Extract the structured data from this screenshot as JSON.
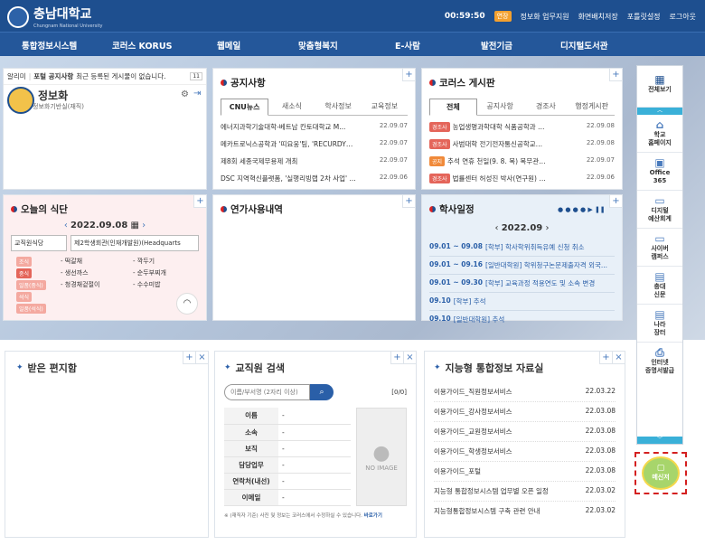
{
  "header": {
    "title": "충남대학교",
    "subtitle": "Chungnam National University",
    "timer": "00:59:50",
    "extend": "연장",
    "links": [
      "정보화 업무지원",
      "화면배치저장",
      "포틀릿설정",
      "로그아웃"
    ]
  },
  "nav": [
    "통합정보시스템",
    "코러스 KORUS",
    "웹메일",
    "맞춤형복지",
    "E-사람",
    "발전기금",
    "디지털도서관"
  ],
  "profile": {
    "notice_prefix": "알리미",
    "notice_bold": "포털 공지사항",
    "notice_rest": "최근 등록된 게시물이 없습니다.",
    "name": "정보화",
    "dept": "정보화기반실(재직)",
    "pager": "11"
  },
  "notice": {
    "title": "공지사항",
    "tabs": [
      "CNU뉴스",
      "새소식",
      "학사정보",
      "교육정보"
    ],
    "items": [
      {
        "t": "에너지과학기술대학-베트남 칸토대학교 M...",
        "d": "22.09.07"
      },
      {
        "t": "메카트로닉스공학과 '띠요웅'팀, 'RECURDYN...",
        "d": "22.09.07"
      },
      {
        "t": "제8회 세종국제무용제 개최",
        "d": "22.09.07"
      },
      {
        "t": "DSC 지역혁신플랫폼, '실행리빙랩 2차 사업' ...",
        "d": "22.09.06"
      }
    ]
  },
  "korus": {
    "title": "코러스 게시판",
    "tabs": [
      "전체",
      "공지사항",
      "경조사",
      "행정게시판"
    ],
    "items": [
      {
        "b": "경조사",
        "bc": "#e4655a",
        "t": "농업생명과학대학 식품공학과 이석건...",
        "d": "22.09.08"
      },
      {
        "b": "경조사",
        "bc": "#e4655a",
        "t": "사범대학 전기전자통신공학교육과 안...",
        "d": "22.09.08"
      },
      {
        "b": "공지",
        "bc": "#f08a3a",
        "t": "추석 연휴 천일(9. 8. 목) 복무관리 철...",
        "d": "22.09.07"
      },
      {
        "b": "경조사",
        "bc": "#e4655a",
        "t": "법률센터 허성진 박사(연구원) 결혼 ...",
        "d": "22.09.06"
      }
    ]
  },
  "meal": {
    "title": "오늘의 식단",
    "date": "2022.09.08",
    "place": "교직원식당",
    "building": "제2학생회관(인재개발원)(Headquarts",
    "labels": [
      "조식",
      "중식",
      "일품(중식)",
      "석식",
      "일품(석식)"
    ],
    "items": [
      "- 떡갈채",
      "- 깍두기",
      "- 생선까스",
      "- 순두부찌개",
      "- 청경채겉절이",
      "- 수수미밥"
    ]
  },
  "yeon": {
    "title": "연가사용내역"
  },
  "schedule": {
    "title": "학사일정",
    "month": "2022.09",
    "items": [
      {
        "d": "09.01 ~ 09.08",
        "t": "[학부] 학사학위취득유예 신청 취소"
      },
      {
        "d": "09.01 ~ 09.16",
        "t": "[일반대학원] 학위청구논문제출자격 외국..."
      },
      {
        "d": "09.01 ~ 09.30",
        "t": "[학부] 교육과정 적용연도 및 소속 변경"
      },
      {
        "d": "09.10",
        "t": "[학부] 추석"
      },
      {
        "d": "09.10",
        "t": "[일반대학원] 추석"
      }
    ]
  },
  "mailbox": {
    "title": "받은 편지함"
  },
  "staff": {
    "title": "교직원 검색",
    "placeholder": "이름/부서명 (2자리 이상)",
    "count": "[0/0]",
    "fields": [
      "이름",
      "소속",
      "보직",
      "담당업무",
      "연락처(내선)",
      "이메일"
    ],
    "dash": "-",
    "noimg": "NO IMAGE",
    "note": "※ (재직자 기준) 사진 및 정보는 코러스에서 수정하실 수 있습니다.",
    "link": "바로가기"
  },
  "ds": {
    "title": "지능형 통합정보 자료실",
    "items": [
      {
        "t": "이용가이드_직원정보서비스",
        "d": "22.03.22"
      },
      {
        "t": "이용가이드_강사정보서비스",
        "d": "22.03.08"
      },
      {
        "t": "이용가이드_교원정보서비스",
        "d": "22.03.08"
      },
      {
        "t": "이용가이드_학생정보서비스",
        "d": "22.03.08"
      },
      {
        "t": "이용가이드_포털",
        "d": "22.03.08"
      },
      {
        "t": "지능형 통합정보시스템 업무별 오픈 일정",
        "d": "22.03.02"
      },
      {
        "t": "지능형통합정보시스템 구축 관련 안내",
        "d": "22.03.02"
      }
    ]
  },
  "side": {
    "all": "전체보기",
    "items": [
      "학교\n홈페이지",
      "Office\n365",
      "디지털\n예산회계",
      "사이버\n캠퍼스",
      "충대\n신문",
      "나라\n장터",
      "인터넷\n증명서발급"
    ],
    "mess": "메신저"
  }
}
